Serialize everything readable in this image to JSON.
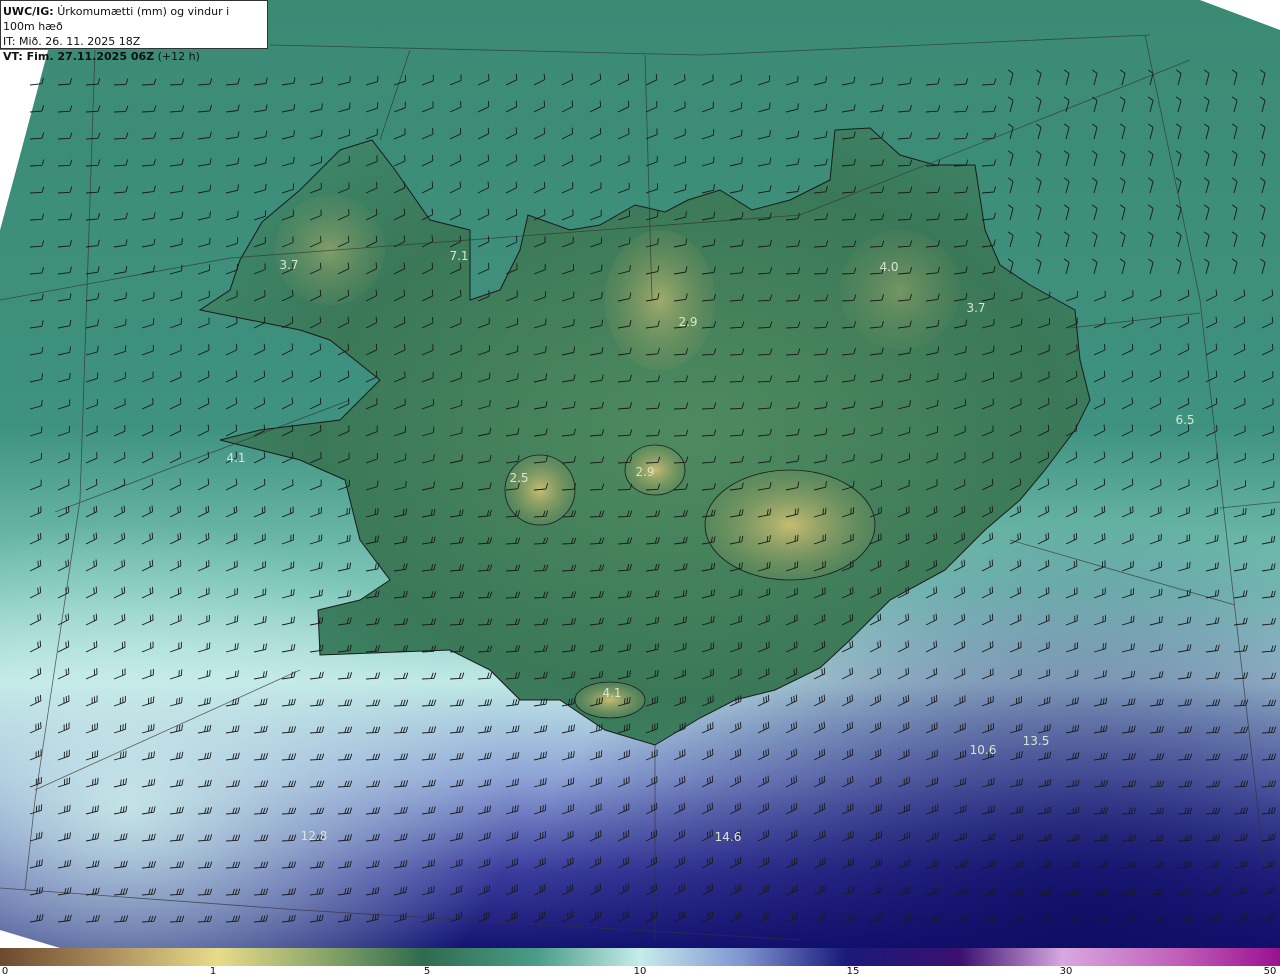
{
  "header": {
    "model_label": "UWC/IG:",
    "product_title": "Úrkomumætti (mm) og vindur i 100m hæð",
    "it_line": "IT: Mið. 26. 11. 2025 18Z",
    "vt_label": "VT: Fim. 27.11.2025 06Z",
    "vt_suffix": "(+12 h)"
  },
  "map": {
    "value_labels": [
      "3.7",
      "7.1",
      "4.0",
      "3.7",
      "2.9",
      "6.5",
      "4.1",
      "2.5",
      "2.9",
      "4.1",
      "10.6",
      "13.5",
      "12.8",
      "14.6"
    ],
    "colors": {
      "ocean_green": "#3f8c78",
      "land_green": "#356f50",
      "highland": "#b8b36a",
      "cyan_band": "#bfe7e4",
      "deep_blue": "#1a1a7a",
      "coastline": "#1a1a1a",
      "barb": "#1a1a1a"
    }
  },
  "colorbar": {
    "ticks": [
      "0",
      "1",
      "5",
      "10",
      "15",
      "30",
      "50"
    ]
  }
}
